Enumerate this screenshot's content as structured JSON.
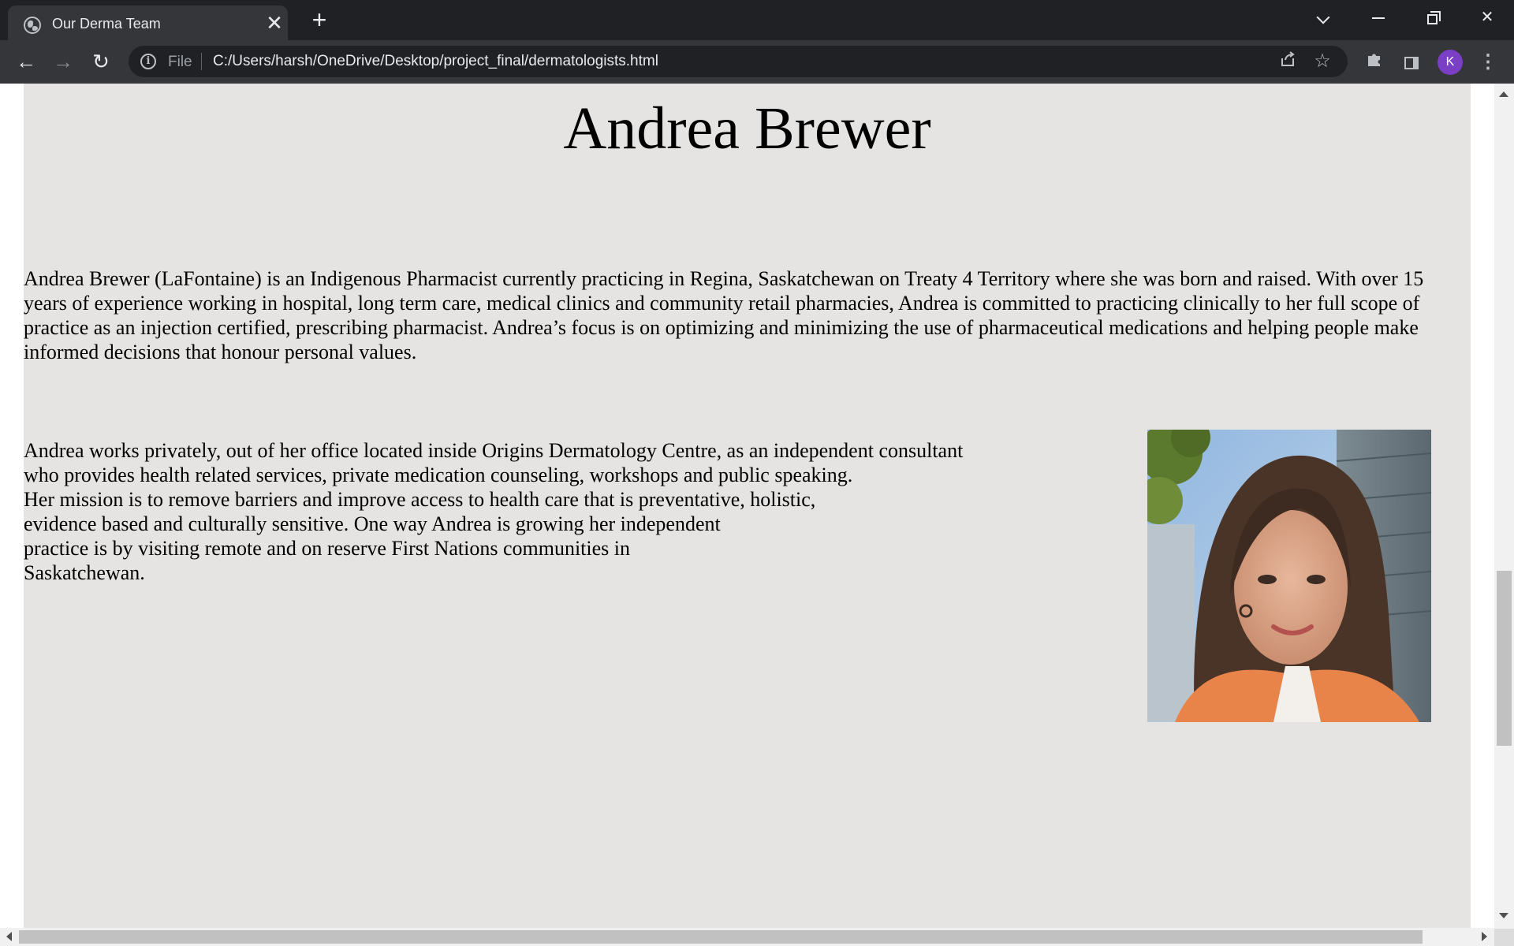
{
  "browser": {
    "tab": {
      "title": "Our Derma Team",
      "favicon": "globe-icon",
      "close": "✕"
    },
    "new_tab": "+",
    "window_controls": {
      "tab_search": "chevron-down-icon",
      "minimize": "minimize-icon",
      "maximize": "restore-icon",
      "close": "✕"
    },
    "toolbar": {
      "back": "←",
      "forward": "→",
      "reload": "↻",
      "security_icon": "info-icon",
      "scheme_label": "File",
      "url": "C:/Users/harsh/OneDrive/Desktop/project_final/dermatologists.html",
      "share_icon": "share-icon",
      "bookmark_icon": "star-icon",
      "extensions_icon": "puzzle-icon",
      "side_panel_icon": "side-panel-icon",
      "profile_initial": "K",
      "menu": "⋮"
    }
  },
  "page": {
    "heading": "Andrea Brewer",
    "paragraph_1": "Andrea Brewer (LaFontaine) is an Indigenous Pharmacist currently practicing in Regina, Saskatchewan on Treaty 4 Territory where she was born and raised. With over 15 years of experience working in hospital, long term care, medical clinics and community retail pharmacies, Andrea is committed to practicing clinically to her full scope of practice as an injection certified, prescribing pharmacist. Andrea’s focus is on optimizing and minimizing the use of pharmaceutical medications and helping people make informed decisions that honour personal values.",
    "paragraph_2_lines": [
      "Andrea works privately, out of her office located inside Origins Dermatology Centre, as an independent consultant",
      "who provides health related services, private medication counseling, workshops and public speaking.",
      "Her mission is to remove barriers and improve access to health care that is preventative, holistic,",
      "evidence based and culturally sensitive. One way Andrea is growing her independent",
      "practice is by visiting remote and on reserve First Nations communities in",
      "Saskatchewan."
    ],
    "portrait_icon": "portrait-photo"
  },
  "colors": {
    "tab_strip": "#202124",
    "toolbar": "#35363a",
    "page_background": "#e5e4e3",
    "profile_avatar": "#7b3fc5"
  }
}
